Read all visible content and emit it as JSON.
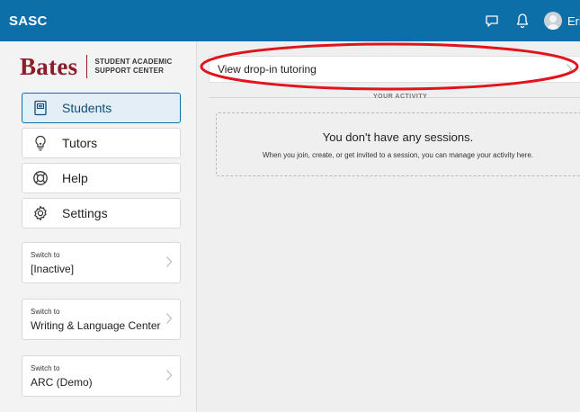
{
  "header": {
    "app_title": "SASC",
    "user_name": "Eri",
    "chat_icon": "chat-bubble-icon",
    "bell_icon": "bell-icon",
    "avatar_icon": "user-avatar-icon"
  },
  "logo": {
    "wordmark": "Bates",
    "subtitle_line1": "STUDENT ACADEMIC",
    "subtitle_line2": "SUPPORT CENTER"
  },
  "sidebar": {
    "items": [
      {
        "label": "Students",
        "icon": "students-icon",
        "active": true
      },
      {
        "label": "Tutors",
        "icon": "lightbulb-icon",
        "active": false
      },
      {
        "label": "Help",
        "icon": "lifebuoy-icon",
        "active": false
      },
      {
        "label": "Settings",
        "icon": "gear-icon",
        "active": false
      }
    ],
    "switch_cards": [
      {
        "prefix": "Switch to",
        "name": "[Inactive]"
      },
      {
        "prefix": "Switch to",
        "name": "Writing & Language Center"
      },
      {
        "prefix": "Switch to",
        "name": "ARC (Demo)"
      }
    ]
  },
  "main": {
    "dropin_label": "View drop-in tutoring",
    "activity_label": "YOUR ACTIVITY",
    "empty_title": "You don't have any sessions.",
    "empty_desc": "When you join, create, or get invited to a session, you can manage your activity here."
  },
  "colors": {
    "brand_blue": "#0d6fa8",
    "bates_maroon": "#8e1b2a",
    "annotation_red": "#e0141b"
  }
}
